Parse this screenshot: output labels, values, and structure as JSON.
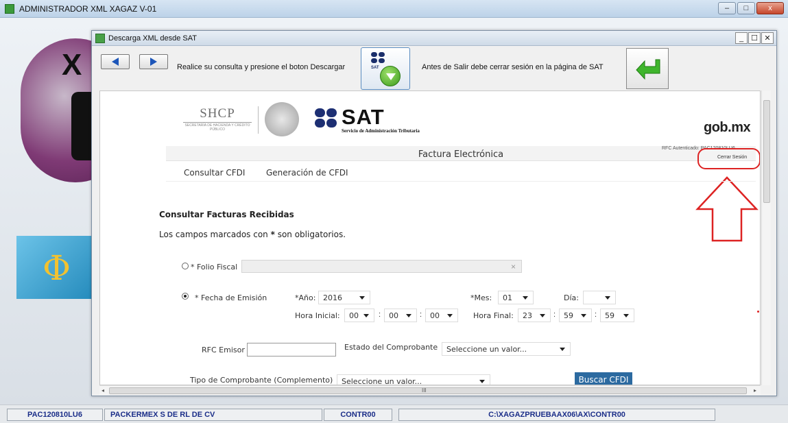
{
  "app": {
    "title": "ADMINISTRADOR XML XAGAZ V-01",
    "controls": {
      "minimize": "–",
      "maximize": "□",
      "close": "x"
    }
  },
  "dialog": {
    "title": "Descarga XML desde SAT",
    "controls": {
      "minimize": "_",
      "maximize": "☐",
      "close": "✕"
    },
    "toolbar": {
      "instruction": "Realice su consulta y presione el boton Descargar",
      "download_icon": "sat-download-icon",
      "download_sat_label": "SAT",
      "logout_note": "Antes de Salir debe cerrar sesión en la página de SAT",
      "exit_icon": "green-return-arrow-icon"
    }
  },
  "sat_page": {
    "shcp_logo": "SHCP",
    "shcp_subtitle": "SECRETARÍA DE HACIENDA Y CRÉDITO PÚBLICO",
    "sat_logo": "SAT",
    "sat_subtitle": "Servicio de Administración Tributaria",
    "gob_logo": "gob.mx",
    "section_title": "Factura Electrónica",
    "rfc_authenticated": "RFC Autenticado: PAC120810LU6",
    "logout_link": "Cerrar Sesión",
    "menu": [
      "Consultar CFDI",
      "Generación de CFDI"
    ],
    "heading": "Consultar Facturas Recibidas",
    "required_note_prefix": "Los campos marcados con ",
    "required_note_star": "*",
    "required_note_suffix": " son obligatorios.",
    "form": {
      "folio_label": "* Folio Fiscal",
      "folio_value": "",
      "folio_clear": "×",
      "fecha_label": "* Fecha de Emisión",
      "anio_label": "*Año:",
      "anio_value": "2016",
      "mes_label": "*Mes:",
      "mes_value": "01",
      "dia_label": "Día:",
      "dia_value": "",
      "hora_inicial_label": "Hora Inicial:",
      "hora_inicial": [
        "00",
        "00",
        "00"
      ],
      "hora_final_label": "Hora Final:",
      "hora_final": [
        "23",
        "59",
        "59"
      ],
      "time_separator": ":",
      "rfc_emisor_label": "RFC Emisor",
      "rfc_emisor_value": "",
      "estado_label": "Estado del Comprobante",
      "estado_value": "Seleccione un valor...",
      "tipo_label": "Tipo de Comprobante (Complemento)",
      "tipo_value": "Seleccione un valor...",
      "search_button": "Buscar CFDI"
    },
    "hscroll_grip": "III"
  },
  "status_bar": {
    "rfc": "PAC120810LU6",
    "company": "PACKERMEX S DE RL DE CV",
    "user": "CONTR00",
    "path": "C:\\XAGAZPRUEBAAX06\\AX\\CONTR00"
  },
  "colors": {
    "accent_blue": "#2c6aa0",
    "annotation_red": "#dd2222",
    "status_text": "#1a2d88"
  }
}
